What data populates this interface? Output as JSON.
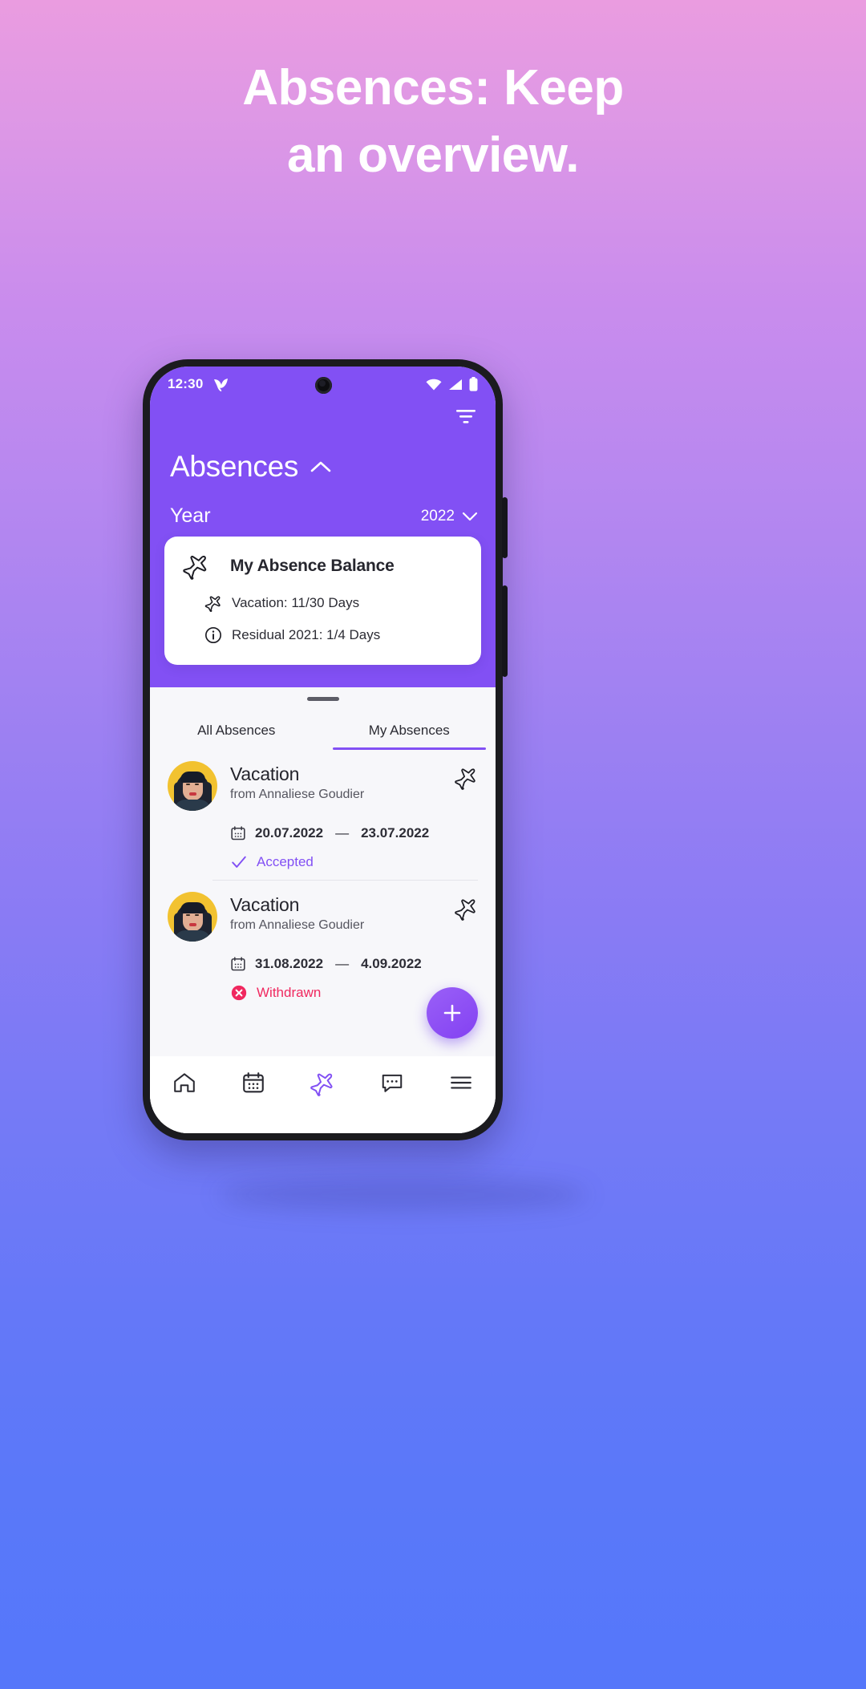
{
  "promo": {
    "line1": "Absences: Keep",
    "line2": "an overview."
  },
  "colors": {
    "brand_purple": "#8250f4",
    "accent_pink": "#f0285f",
    "avatar_bg": "#f2c230",
    "sheet_bg": "#f7f7fa",
    "bg_top": "#ea9ce0",
    "bg_bottom": "#5577fa"
  },
  "statusbar": {
    "time": "12:30",
    "app_icon": "bird-logo-icon",
    "wifi_icon": "wifi-icon",
    "signal_icon": "signal-icon",
    "battery_icon": "battery-icon"
  },
  "header": {
    "filter_icon": "filter-icon",
    "title": "Absences",
    "title_chevron": "chevron-up-icon",
    "year_label": "Year",
    "year_value": "2022",
    "year_chevron": "chevron-down-icon"
  },
  "balance_card": {
    "icon": "airplane-icon",
    "title": "My Absence Balance",
    "lines": [
      {
        "icon": "airplane-icon",
        "text": "Vacation: 11/30 Days"
      },
      {
        "icon": "info-icon",
        "text": "Residual 2021: 1/4 Days"
      }
    ]
  },
  "tabs": [
    {
      "label": "All Absences",
      "active": false
    },
    {
      "label": "My Absences",
      "active": true
    }
  ],
  "absences": [
    {
      "title": "Vacation",
      "subtitle": "from Annaliese Goudier",
      "type_icon": "airplane-icon",
      "date_icon": "calendar-icon",
      "date_from": "20.07.2022",
      "date_sep": "—",
      "date_to": "23.07.2022",
      "status": "Accepted",
      "status_icon": "check-icon",
      "status_kind": "accepted"
    },
    {
      "title": "Vacation",
      "subtitle": "from Annaliese Goudier",
      "type_icon": "airplane-icon",
      "date_icon": "calendar-icon",
      "date_from": "31.08.2022",
      "date_sep": "—",
      "date_to": "4.09.2022",
      "status": "Withdrawn",
      "status_icon": "x-circle-icon",
      "status_kind": "withdrawn"
    }
  ],
  "fab": {
    "icon": "plus-icon"
  },
  "bottom_nav": [
    {
      "icon": "home-icon",
      "active": false
    },
    {
      "icon": "calendar-icon",
      "active": false
    },
    {
      "icon": "airplane-icon",
      "active": true
    },
    {
      "icon": "chat-icon",
      "active": false
    },
    {
      "icon": "menu-icon",
      "active": false
    }
  ]
}
